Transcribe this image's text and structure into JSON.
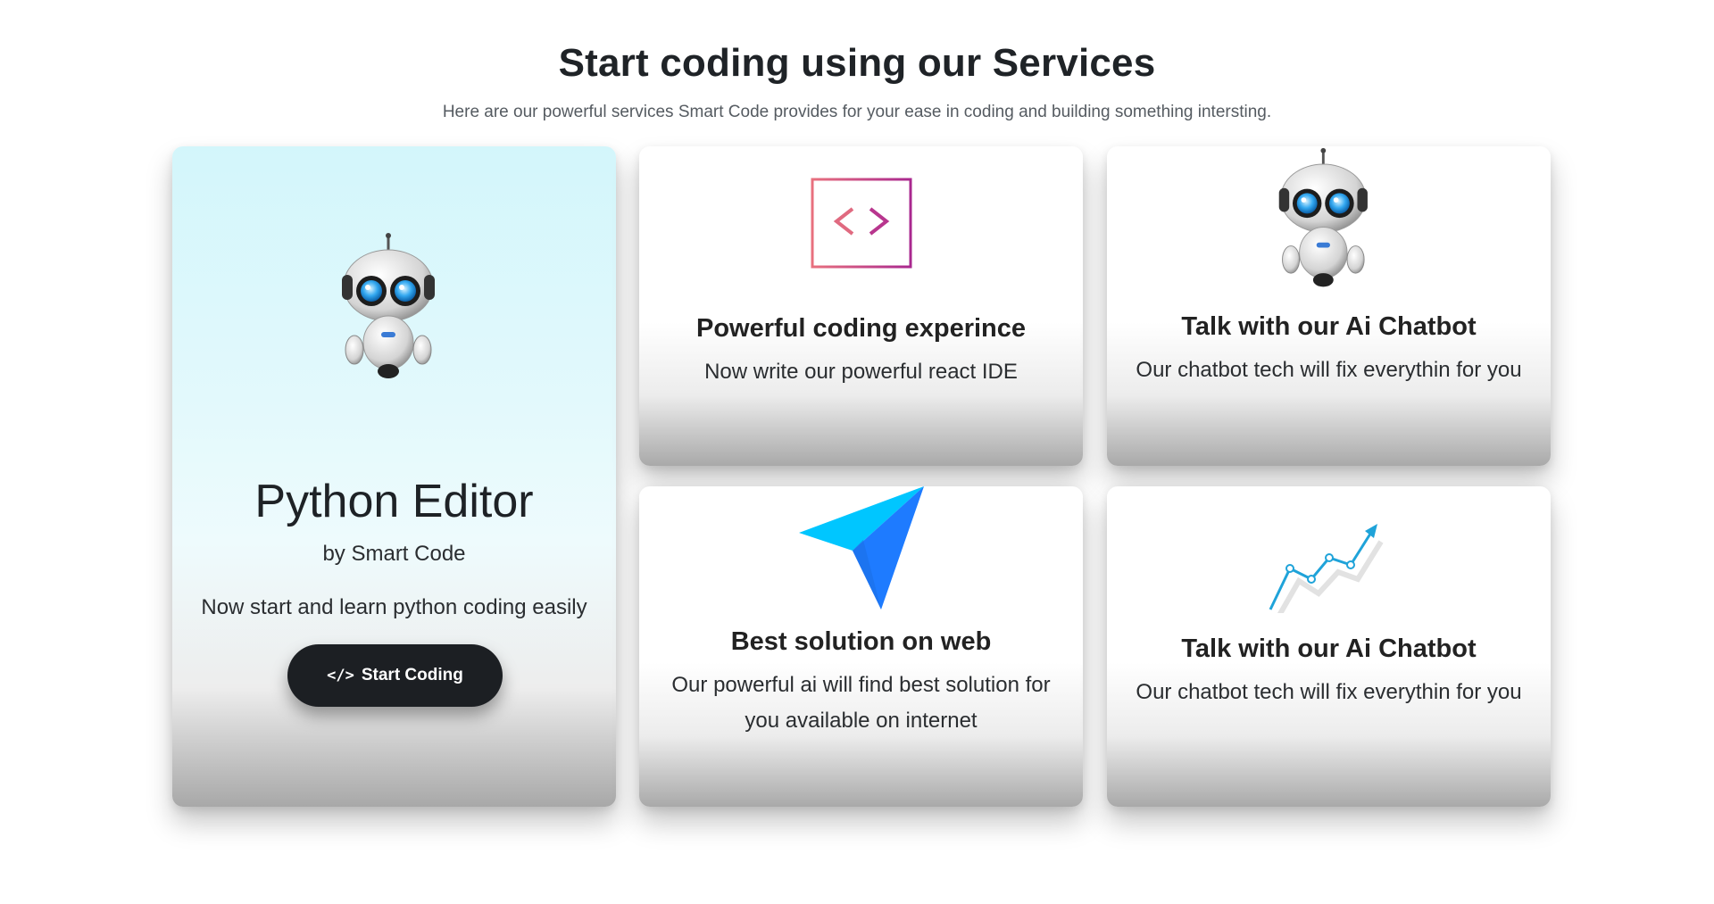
{
  "section": {
    "title": "Start coding using our Services",
    "subtitle": "Here are our powerful services Smart Code provides for your ease in coding and building something intersting."
  },
  "featured": {
    "title": "Python Editor",
    "by": "by Smart Code",
    "description": "Now start and learn python coding easily",
    "button_label": "Start Coding",
    "button_icon": "code-icon",
    "illustration": "robot-icon"
  },
  "cards": [
    {
      "title": "Powerful coding experince",
      "text": "Now write our powerful react IDE",
      "icon": "monitor-code-icon"
    },
    {
      "title": "Talk with our Ai Chatbot",
      "text": "Our chatbot tech will fix everythin for you",
      "icon": "robot-icon"
    },
    {
      "title": "Best solution on web",
      "text": "Our powerful ai will find best solution for you available on internet",
      "icon": "paper-plane-icon"
    },
    {
      "title": "Talk with our Ai Chatbot",
      "text": "Our chatbot tech will fix everythin for you",
      "icon": "trend-chart-icon"
    }
  ],
  "colors": {
    "button_bg": "#1c1f23",
    "featured_bg_top": "#d3f6fb",
    "monitor_gradient_start": "#e8707e",
    "monitor_gradient_end": "#a9288f",
    "plane_light": "#00c6ff",
    "plane_dark": "#1e7bff",
    "chart_line": "#1fa3d9"
  }
}
